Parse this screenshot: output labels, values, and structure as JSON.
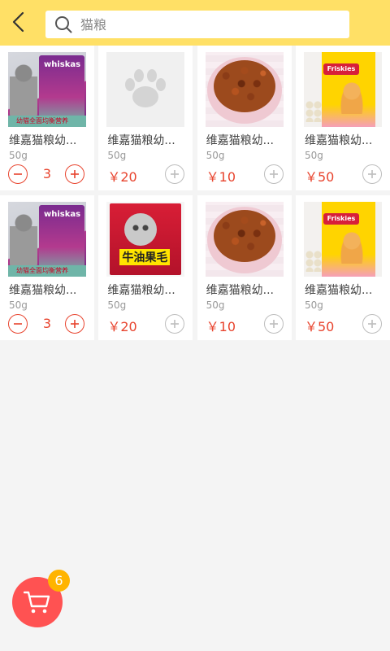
{
  "header": {
    "search_placeholder": "猫粮",
    "search_value": "",
    "accent_color": "#ffe066"
  },
  "products": [
    [
      {
        "name": "维嘉猫粮幼...",
        "weight": "50g",
        "price": "",
        "qty": "3",
        "image": "whiskas",
        "mode": "stepper"
      },
      {
        "name": "维嘉猫粮幼...",
        "weight": "50g",
        "price": "￥20",
        "qty": "",
        "image": "placeholder-paw",
        "mode": "add"
      },
      {
        "name": "维嘉猫粮幼...",
        "weight": "50g",
        "price": "￥10",
        "qty": "",
        "image": "bowl",
        "mode": "add"
      },
      {
        "name": "维嘉猫粮幼...",
        "weight": "50g",
        "price": "￥50",
        "qty": "",
        "image": "friskies",
        "mode": "add"
      }
    ],
    [
      {
        "name": "维嘉猫粮幼...",
        "weight": "50g",
        "price": "",
        "qty": "3",
        "image": "whiskas",
        "mode": "stepper"
      },
      {
        "name": "维嘉猫粮幼...",
        "weight": "50g",
        "price": "￥20",
        "qty": "",
        "image": "redbag",
        "mode": "add"
      },
      {
        "name": "维嘉猫粮幼...",
        "weight": "50g",
        "price": "￥10",
        "qty": "",
        "image": "bowl",
        "mode": "add"
      },
      {
        "name": "维嘉猫粮幼...",
        "weight": "50g",
        "price": "￥50",
        "qty": "",
        "image": "friskies",
        "mode": "add"
      }
    ]
  ],
  "image_text": {
    "whiskas_label": "whiskas",
    "whiskas_stripe": "幼猫全面均衡营养",
    "friskies_logo": "Friskies",
    "redbag_brand": "牛油果毛"
  },
  "cart": {
    "badge_count": "6",
    "color": "#ff5252",
    "badge_color": "#ffb400"
  }
}
